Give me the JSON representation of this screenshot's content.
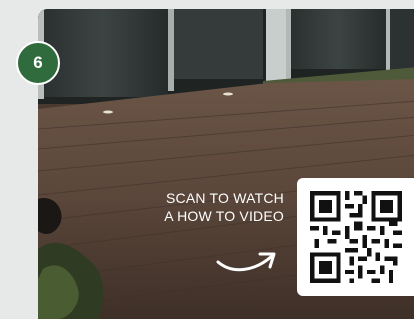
{
  "step": {
    "number": "6"
  },
  "cta": {
    "line1": "SCAN TO WATCH",
    "line2": "A HOW TO VIDEO"
  },
  "colors": {
    "badge": "#2f6b3d",
    "background": "#e6e9e7",
    "text_on_photo": "#ffffff"
  },
  "icons": {
    "arrow": "curved-arrow-right-icon",
    "qr": "qr-code"
  }
}
